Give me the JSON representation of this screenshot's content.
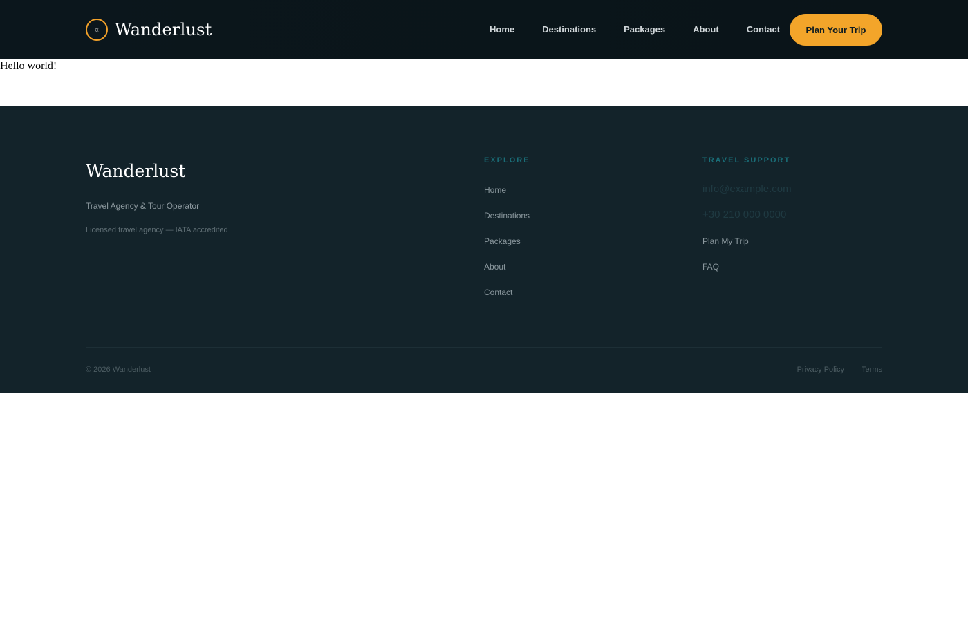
{
  "header": {
    "brand_name": "Wanderlust",
    "brand_icon": "sun-icon",
    "nav": [
      {
        "label": "Home"
      },
      {
        "label": "Destinations"
      },
      {
        "label": "Packages"
      },
      {
        "label": "About"
      },
      {
        "label": "Contact"
      }
    ],
    "cta_label": "Plan Your Trip"
  },
  "main": {
    "text": "Hello world!"
  },
  "footer": {
    "brand_name": "Wanderlust",
    "tagline": "Travel Agency & Tour Operator",
    "license": "Licensed travel agency — IATA accredited",
    "explore": {
      "title": "EXPLORE",
      "links": [
        "Home",
        "Destinations",
        "Packages",
        "About",
        "Contact"
      ]
    },
    "support": {
      "title": "TRAVEL SUPPORT",
      "email": "info@example.com",
      "phone": "+30 210 000 0000",
      "links": [
        "Plan My Trip",
        "FAQ"
      ]
    },
    "copyright": "© 2026 Wanderlust",
    "legal": [
      "Privacy Policy",
      "Terms"
    ]
  },
  "colors": {
    "header_bg": "#0b161c",
    "footer_bg": "#13232a",
    "accent": "#f3a52a",
    "section_title": "#1a6d77"
  }
}
